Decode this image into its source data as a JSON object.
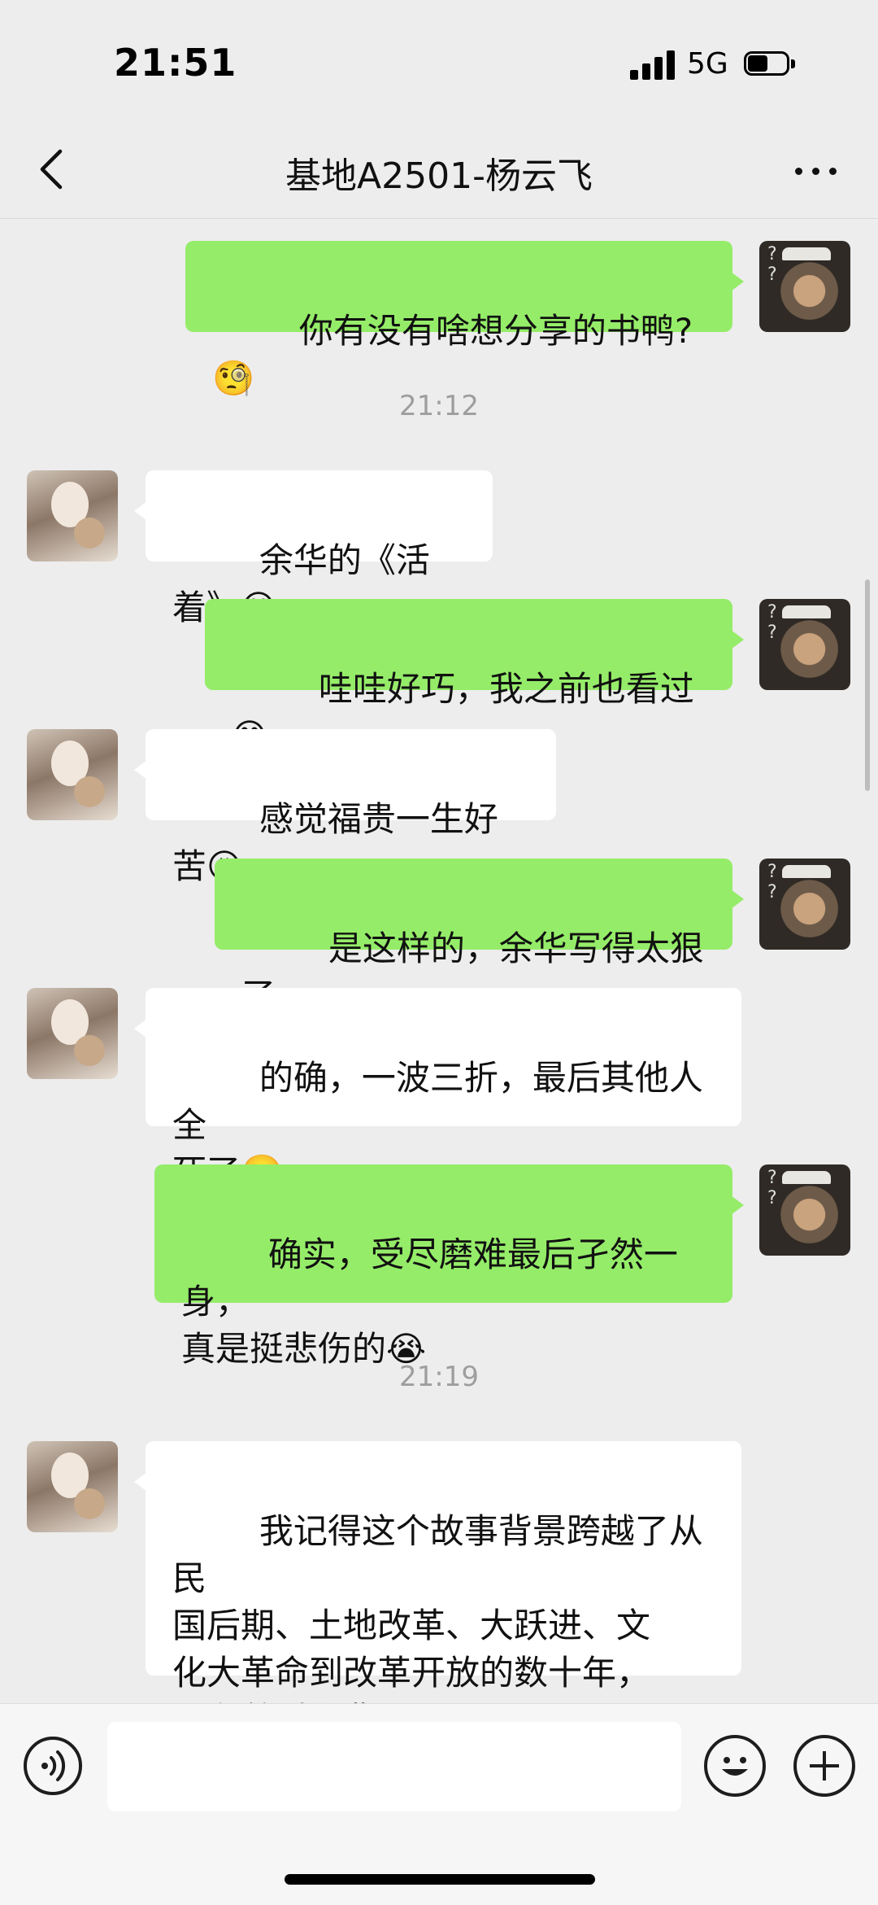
{
  "status_bar": {
    "time": "21:51",
    "network": "5G"
  },
  "nav": {
    "title": "基地A2501-杨云飞"
  },
  "messages": [
    {
      "sender": "me",
      "text": "你有没有啥想分享的书鸭?🧐"
    },
    {
      "type": "time",
      "text": "21:12"
    },
    {
      "sender": "other",
      "text": "余华的《活着》😁"
    },
    {
      "sender": "me",
      "text": "哇哇好巧，我之前也看过😁"
    },
    {
      "sender": "other",
      "text": "感觉福贵一生好苦😖"
    },
    {
      "sender": "me",
      "text": "是这样的，余华写得太狠了"
    },
    {
      "sender": "other",
      "text": "的确，一波三折，最后其他人全\n死了🙄"
    },
    {
      "sender": "me",
      "text": "确实，受尽磨难最后孑然一身，\n真是挺悲伤的😭"
    },
    {
      "type": "time",
      "text": "21:19"
    },
    {
      "sender": "other",
      "text": "我记得这个故事背景跨越了从民\n国后期、土地改革、大跃进、文\n化大革命到改革开放的数十年，\n还有着时代背景呢😳"
    }
  ],
  "input": {
    "value": ""
  },
  "icons": {
    "back": "chevron-left-icon",
    "more": "more-dots-icon",
    "voice": "voice-icon",
    "emoji": "emoji-icon",
    "plus": "plus-icon"
  },
  "colors": {
    "background": "#ededed",
    "my_bubble": "#95ec69",
    "other_bubble": "#ffffff",
    "timestamp": "#9e9e9e"
  }
}
